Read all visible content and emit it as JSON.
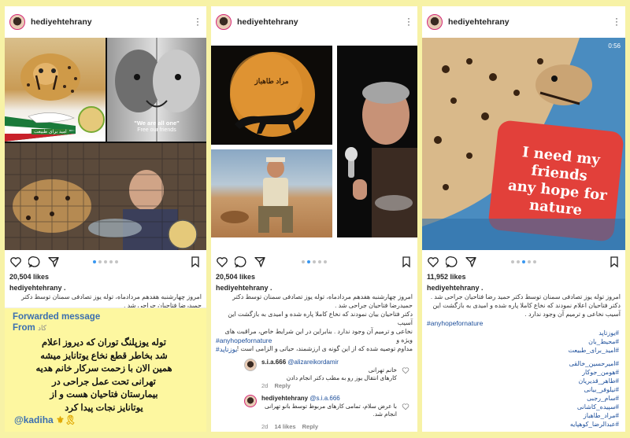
{
  "colors": {
    "page_bg": "#f7f2a6",
    "accent_blue": "#3897f0",
    "hashtag": "#1c4e9a"
  },
  "posts": [
    {
      "username": "hediyehtehrany",
      "media_texts": {
        "badge": "امید برای طبیعت",
        "quote_line1": "\"We are all one\"",
        "quote_line2": "Free our friends"
      },
      "likes": "20,504 likes",
      "caption_user": "hediyehtehrany .",
      "caption_lines": [
        "امروز چهارشنبه هفدهم مردادماه، توله یوز تصادفی سمنان توسط دکتر",
        "حمیدرضا فتاحیان جراحی شد ."
      ],
      "forwarded": {
        "title": "Forwarded message",
        "from": "From",
        "from_name": "کاد",
        "lines": [
          "توله یوزپلنگ توران که دیروز اعلام",
          "شد بخاطر قطع نخاع یوتانایز میشه",
          "همین الان با زحمت سرکار خانم هدیه",
          "تهرانی تحت عمل جراحی در",
          "بیمارستان فتاحیان هست و از",
          "یوتانایز نجات پیدا کرد"
        ],
        "signature": "@kadiha",
        "emoji": "⚜🎗"
      }
    },
    {
      "username": "hediyehtehrany",
      "media_texts": {
        "moon_text": "مراد طاهباز"
      },
      "likes": "20,504 likes",
      "caption_user": "hediyehtehrany .",
      "caption_lines": [
        "امروز چهارشنبه هفدهم مردادماه، توله یوز تصادفی سمنان توسط دکتر",
        "حمیدرضا فتاحیان جراحی شد .",
        "دکتر فتاحیان بیان نمودند که نخاع کاملا پاره شده و امیدی به بازگشت این آسیب",
        "نخاعی و ترمیم آن وجود ندارد . بنابراین در این شرایط خاص، مراقبت های ویژه و",
        "مداوم توصیه شده که از این گونه ی ارزشمند، حیاتی و الزامی است !"
      ],
      "hashtags": [
        "#یوزتاپد",
        "#anyhopefornature"
      ],
      "comments": [
        {
          "user": "s.i.a.666",
          "mention": "@alizareikordamir",
          "lines": [
            "خانم تهرانی",
            "کارهای انتقال یوز رو به مطب دکتر انجام دادن"
          ],
          "meta_time": "2d",
          "meta_reply": "Reply"
        },
        {
          "user": "hediyehtehrany",
          "mention": "@s.i.a.666",
          "lines": [
            "با عرض سلام، تمامی کارهای مربوط توسط بانو تهرانی",
            "انجام شد."
          ],
          "meta_time": "2d",
          "meta_likes": "14 likes",
          "meta_reply": "Reply"
        }
      ]
    },
    {
      "username": "hediyehtehrany",
      "media_texts": {
        "video_time": "0:56",
        "sign_line1": "I need my friends",
        "sign_line2": "any hope for nature"
      },
      "likes": "11,952 likes",
      "caption_user": "hediyehtehrany .",
      "caption_lines": [
        "امروز توله یوز تصادفی سمنان توسط دکتر حمید رضا فتاحیان جراحی شد .",
        "دکتر فتاحیان اعلام نمودند که نخاع کاملا پاره شده و امیدی به بازگشت این",
        "آسیب نخاعی و ترمیم آن وجود ندارد ."
      ],
      "hashtags_en": [
        "#anyhopefornature"
      ],
      "hashtags_fa": [
        "#یوزتاپد",
        "#محیط_بان",
        "#امید_برای_طبیعت",
        "#امیرحسین_خالقی",
        "#هومن_جوکار",
        "#طاهر_قدیریان",
        "#نیلوفر_بیانی",
        "#سام_رجبی",
        "#سپیده_کاشانی",
        "#مراد_طاهباز",
        "#عبدالرضا_کوهپایه"
      ]
    }
  ]
}
